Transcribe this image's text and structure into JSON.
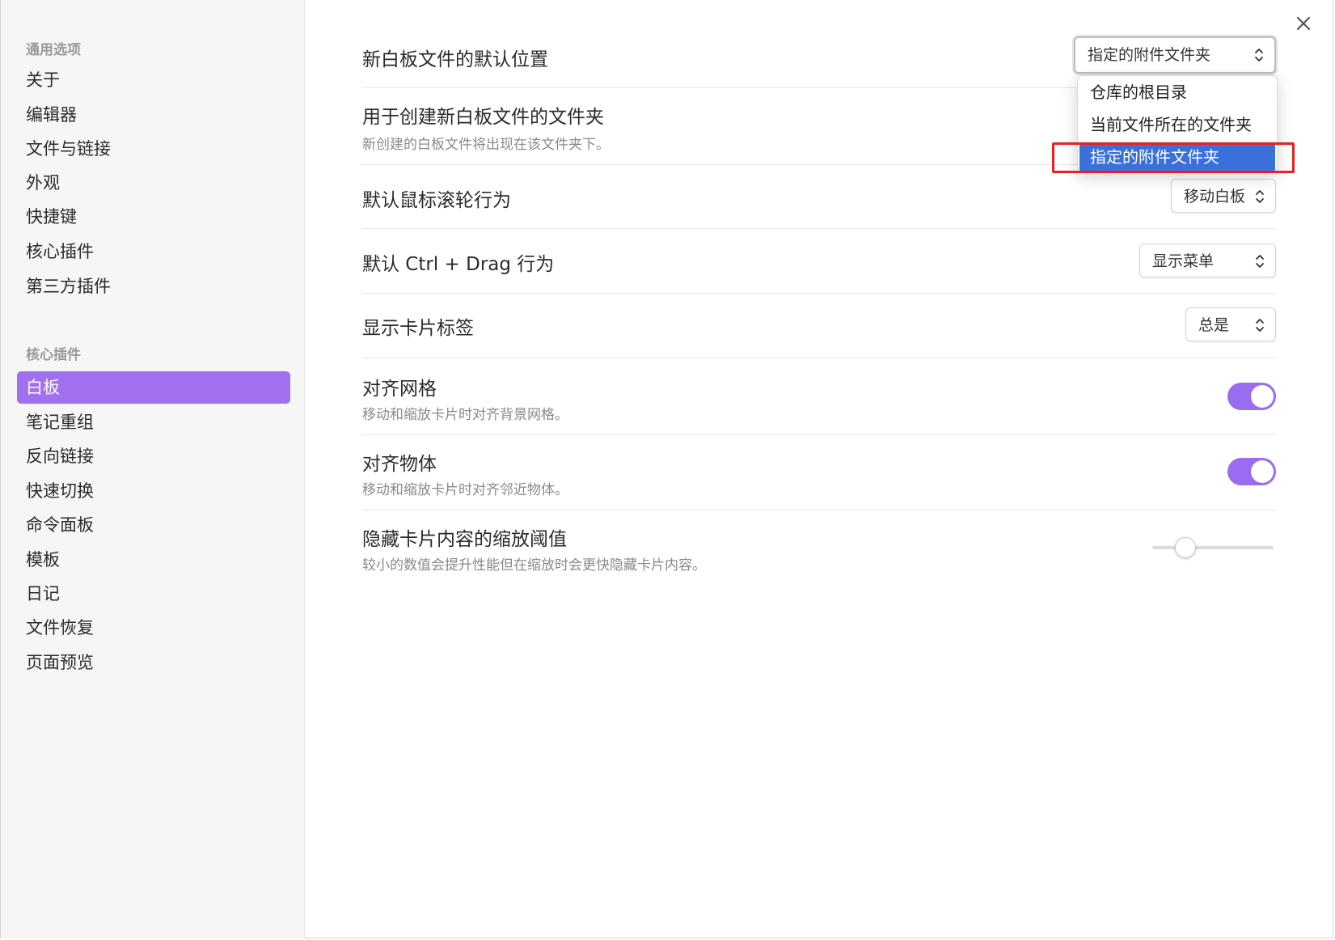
{
  "sidebar": {
    "section_general": "通用选项",
    "general_items": [
      "关于",
      "编辑器",
      "文件与链接",
      "外观",
      "快捷键",
      "核心插件",
      "第三方插件"
    ],
    "section_core": "核心插件",
    "core_items": [
      "白板",
      "笔记重组",
      "反向链接",
      "快速切换",
      "命令面板",
      "模板",
      "日记",
      "文件恢复",
      "页面预览"
    ],
    "active_item": "白板"
  },
  "settings": {
    "default_location": {
      "name": "新白板文件的默认位置",
      "value": "指定的附件文件夹"
    },
    "folder": {
      "name": "用于创建新白板文件的文件夹",
      "desc": "新创建的白板文件将出现在该文件夹下。"
    },
    "scroll": {
      "name": "默认鼠标滚轮行为",
      "value": "移动白板"
    },
    "ctrl_drag": {
      "name": "默认 Ctrl + Drag 行为",
      "value": "显示菜单"
    },
    "card_label": {
      "name": "显示卡片标签",
      "value": "总是"
    },
    "snap_grid": {
      "name": "对齐网格",
      "desc": "移动和缩放卡片时对齐背景网格。",
      "enabled": true
    },
    "snap_objects": {
      "name": "对齐物体",
      "desc": "移动和缩放卡片时对齐邻近物体。",
      "enabled": true
    },
    "zoom_threshold": {
      "name": "隐藏卡片内容的缩放阈值",
      "desc": "较小的数值会提升性能但在缩放时会更快隐藏卡片内容。",
      "value_fraction": 0.27
    }
  },
  "dropdown_menu": {
    "options": [
      "仓库的根目录",
      "当前文件所在的文件夹",
      "指定的附件文件夹"
    ],
    "selected_index": 2
  },
  "colors": {
    "accent": "#a070f0",
    "toggle_on": "#9a6cf0",
    "menu_selected": "#3b6fdc",
    "highlight_border": "#e8201f"
  },
  "icons": {
    "close": "close-icon",
    "dropdown": "chevron-updown-icon"
  }
}
